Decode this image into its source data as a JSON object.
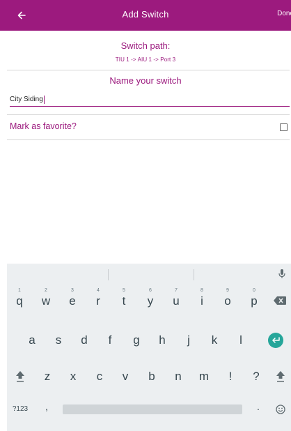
{
  "app_bar": {
    "title": "Add Switch",
    "done_label": "Done",
    "back_icon": "arrow-left-icon",
    "color": "#9c1a7e"
  },
  "path": {
    "heading": "Switch path:",
    "value": "TIU 1 -> AIU 1 -> Port 3"
  },
  "name": {
    "heading": "Name your switch",
    "value": "City Siding"
  },
  "favorite": {
    "label": "Mark as favorite?",
    "checked": false
  },
  "keyboard": {
    "row1": [
      {
        "key": "q",
        "hint": "1"
      },
      {
        "key": "w",
        "hint": "2"
      },
      {
        "key": "e",
        "hint": "3"
      },
      {
        "key": "r",
        "hint": "4"
      },
      {
        "key": "t",
        "hint": "5"
      },
      {
        "key": "y",
        "hint": "6"
      },
      {
        "key": "u",
        "hint": "7"
      },
      {
        "key": "i",
        "hint": "8"
      },
      {
        "key": "o",
        "hint": "9"
      },
      {
        "key": "p",
        "hint": "0"
      }
    ],
    "row2": [
      "a",
      "s",
      "d",
      "f",
      "g",
      "h",
      "j",
      "k",
      "l"
    ],
    "row3": [
      "z",
      "x",
      "c",
      "v",
      "b",
      "n",
      "m",
      "!",
      "?"
    ],
    "symbols_label": "?123",
    "comma": ",",
    "period": ".",
    "icons": [
      "mic-icon",
      "backspace-icon",
      "enter-icon",
      "shift-icon",
      "emoji-icon"
    ],
    "enter_color": "#26a69a"
  }
}
